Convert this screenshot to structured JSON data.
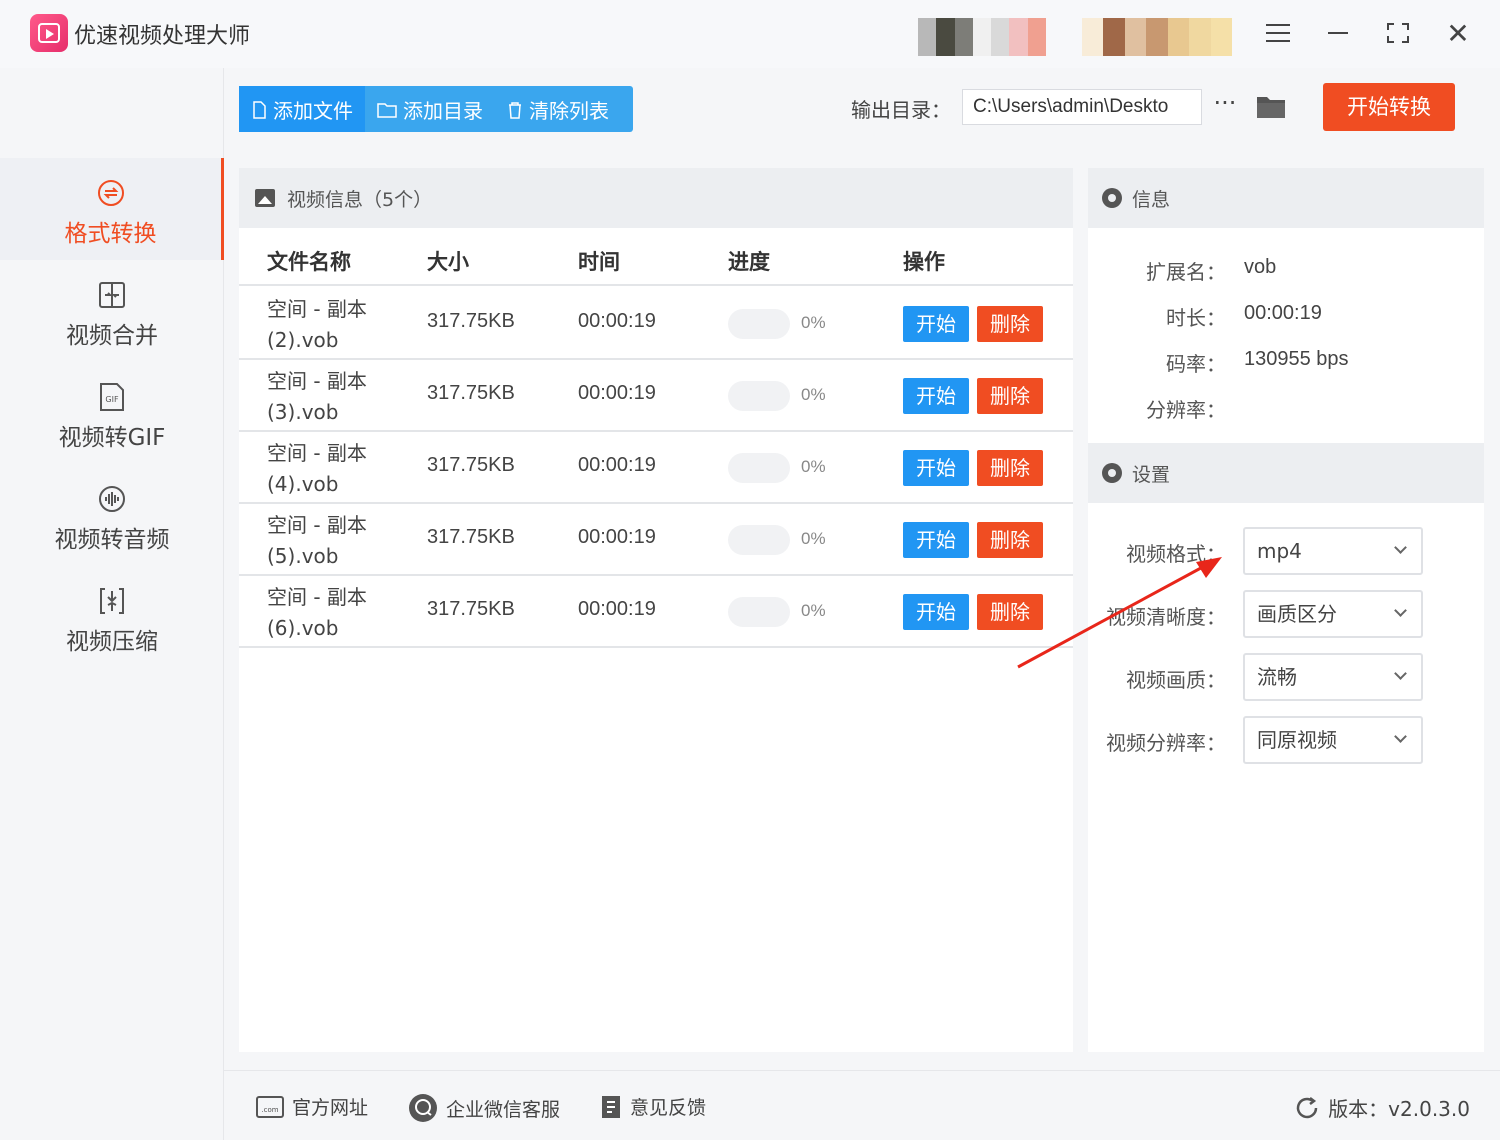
{
  "app": {
    "title": "优速视频处理大师"
  },
  "colors": {
    "accent_red": "#f04d22",
    "accent_blue": "#2196f3",
    "toolbar_blue": "#3aa6ee"
  },
  "sidebar": {
    "items": [
      {
        "label": "格式转换",
        "icon": "format-convert-icon",
        "active": true
      },
      {
        "label": "视频合并",
        "icon": "video-merge-icon"
      },
      {
        "label": "视频转GIF",
        "icon": "gif-icon",
        "badge": "GIF"
      },
      {
        "label": "视频转音频",
        "icon": "audio-wave-icon"
      },
      {
        "label": "视频压缩",
        "icon": "compress-icon"
      }
    ]
  },
  "toolbar": {
    "add_file": "添加文件",
    "add_dir": "添加目录",
    "clear_list": "清除列表",
    "output_label": "输出目录：",
    "output_path": "C:\\Users\\admin\\Deskto",
    "more": "···",
    "start_convert": "开始转换"
  },
  "file_panel": {
    "title": "视频信息（5个）",
    "columns": [
      "文件名称",
      "大小",
      "时间",
      "进度",
      "操作"
    ],
    "rows": [
      {
        "name": "空间 - 副本 (2).vob",
        "size": "317.75KB",
        "time": "00:00:19",
        "progress": 0,
        "progress_text": "0%",
        "start": "开始",
        "delete": "删除"
      },
      {
        "name": "空间 - 副本 (3).vob",
        "size": "317.75KB",
        "time": "00:00:19",
        "progress": 0,
        "progress_text": "0%",
        "start": "开始",
        "delete": "删除"
      },
      {
        "name": "空间 - 副本 (4).vob",
        "size": "317.75KB",
        "time": "00:00:19",
        "progress": 0,
        "progress_text": "0%",
        "start": "开始",
        "delete": "删除"
      },
      {
        "name": "空间 - 副本 (5).vob",
        "size": "317.75KB",
        "time": "00:00:19",
        "progress": 0,
        "progress_text": "0%",
        "start": "开始",
        "delete": "删除"
      },
      {
        "name": "空间 - 副本 (6).vob",
        "size": "317.75KB",
        "time": "00:00:19",
        "progress": 0,
        "progress_text": "0%",
        "start": "开始",
        "delete": "删除"
      }
    ]
  },
  "info": {
    "title": "信息",
    "ext_label": "扩展名：",
    "ext": "vob",
    "duration_label": "时长：",
    "duration": "00:00:19",
    "bitrate_label": "码率：",
    "bitrate": "130955 bps",
    "resolution_label": "分辨率：",
    "resolution": ""
  },
  "settings": {
    "title": "设置",
    "format_label": "视频格式：",
    "format": "mp4",
    "clarity_label": "视频清晰度：",
    "clarity": "画质区分",
    "quality_label": "视频画质：",
    "quality": "流畅",
    "resolution_label": "视频分辨率：",
    "resolution": "同原视频"
  },
  "footer": {
    "website": "官方网址",
    "wechat": "企业微信客服",
    "feedback": "意见反馈",
    "version": "版本：v2.0.3.0"
  }
}
